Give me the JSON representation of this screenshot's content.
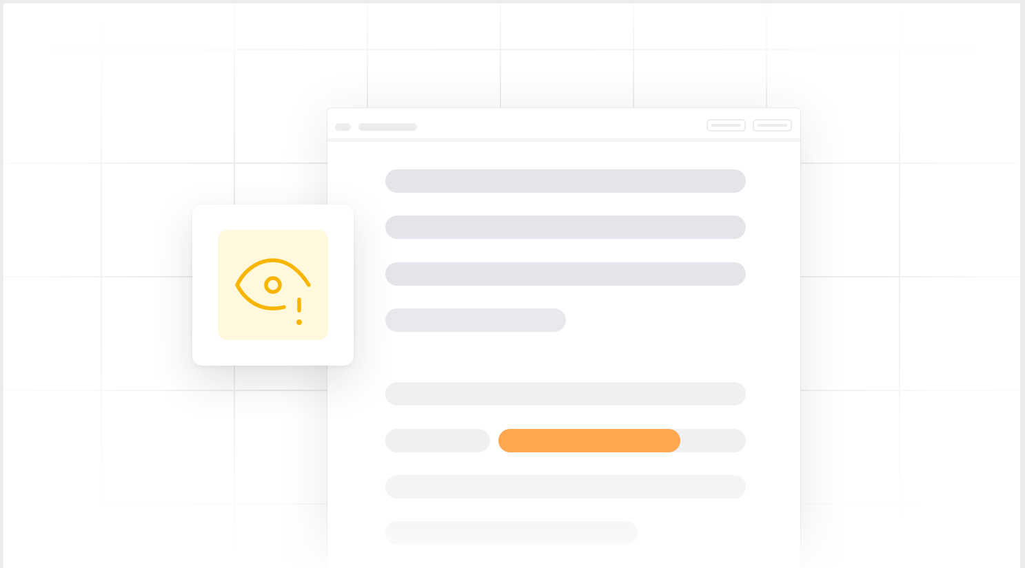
{
  "icons": {
    "alert_icon": "eye-warning-icon"
  },
  "colors": {
    "background": "#ffffff",
    "grid_line": "#ececee",
    "placeholder_bar": "#e4e4ea",
    "accent_bar": "#ffa74f",
    "icon_stroke": "#f7b500",
    "icon_tile": "#fff8dc"
  }
}
